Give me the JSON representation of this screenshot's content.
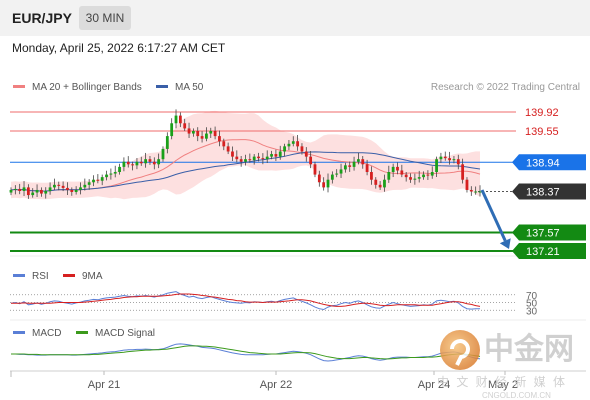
{
  "header": {
    "symbol": "EUR/JPY",
    "timeframe": "30 MIN"
  },
  "datetime": "Monday, April 25, 2022 6:17:27 AM CET",
  "colors": {
    "ma20": "#f08080",
    "ma50": "#3a5fa8",
    "bollinger_fill": "#fde0e0",
    "resistance": "#ef6b6b",
    "pivot": "#1a73e8",
    "support": "#138a13",
    "price": "#333333",
    "arrow": "#2f6db5",
    "rsi": "#5a7fd6",
    "rsi_ma": "#d62020",
    "macd": "#5a7fd6",
    "macd_signal": "#3c9a1c",
    "candle_up": "#1aa01a",
    "candle_down": "#d62020"
  },
  "chart_data": [
    {
      "type": "candlestick",
      "title": "",
      "legend": [
        {
          "name": "MA 20 + Bollinger Bands",
          "color": "#f08080"
        },
        {
          "name": "MA 50",
          "color": "#3a5fa8"
        }
      ],
      "legend_position": "top-left",
      "credit": "Research © 2022 Trading Central",
      "x_tick_labels": [
        "Apr 21",
        "Apr 22",
        "Apr 24",
        "May 2"
      ],
      "ylim": [
        137.1,
        140.05
      ],
      "current_price": 138.37,
      "levels": [
        {
          "label": "139.92",
          "value": 139.92,
          "role": "resistance"
        },
        {
          "label": "139.55",
          "value": 139.55,
          "role": "resistance"
        },
        {
          "label": "138.94",
          "value": 138.94,
          "role": "pivot"
        },
        {
          "label": "138.37",
          "value": 138.37,
          "role": "price"
        },
        {
          "label": "137.57",
          "value": 137.57,
          "role": "support"
        },
        {
          "label": "137.21",
          "value": 137.21,
          "role": "support"
        }
      ],
      "forecast_arrow": {
        "from": 138.4,
        "to": 137.25
      },
      "close_series": [
        138.4,
        138.42,
        138.38,
        138.45,
        138.3,
        138.35,
        138.4,
        138.33,
        138.38,
        138.45,
        138.5,
        138.48,
        138.44,
        138.4,
        138.36,
        138.4,
        138.45,
        138.5,
        138.55,
        138.6,
        138.58,
        138.65,
        138.7,
        138.72,
        138.75,
        138.85,
        138.95,
        138.9,
        138.88,
        138.95,
        138.92,
        139.0,
        138.95,
        138.9,
        139.0,
        139.2,
        139.45,
        139.7,
        139.85,
        139.7,
        139.6,
        139.5,
        139.55,
        139.45,
        139.4,
        139.5,
        139.55,
        139.45,
        139.35,
        139.25,
        139.15,
        139.05,
        139.0,
        138.95,
        139.0,
        138.98,
        139.05,
        139.02,
        139.0,
        139.05,
        139.1,
        139.05,
        139.15,
        139.25,
        139.3,
        139.35,
        139.25,
        139.15,
        139.05,
        138.9,
        138.7,
        138.55,
        138.45,
        138.6,
        138.7,
        138.72,
        138.8,
        138.88,
        138.85,
        138.95,
        139.0,
        138.9,
        138.75,
        138.6,
        138.5,
        138.45,
        138.6,
        138.75,
        138.85,
        138.78,
        138.7,
        138.65,
        138.6,
        138.62,
        138.65,
        138.7,
        138.68,
        138.75,
        139.0,
        139.05,
        139.02,
        138.98,
        139.0,
        138.9,
        138.6,
        138.4,
        138.37,
        138.37,
        138.37
      ]
    },
    {
      "type": "line",
      "title": "RSI",
      "series": [
        {
          "name": "RSI"
        },
        {
          "name": "9MA"
        }
      ],
      "y_tick_labels": [
        "70",
        "50",
        "30"
      ],
      "levels": [
        70,
        50,
        30
      ],
      "ylim": [
        10,
        90
      ],
      "rsi": [
        48,
        50,
        47,
        52,
        44,
        46,
        49,
        45,
        48,
        52,
        54,
        53,
        50,
        48,
        46,
        49,
        51,
        54,
        56,
        58,
        57,
        60,
        62,
        63,
        64,
        66,
        68,
        66,
        65,
        67,
        66,
        68,
        66,
        64,
        67,
        70,
        74,
        76,
        78,
        72,
        68,
        64,
        66,
        62,
        60,
        63,
        65,
        61,
        58,
        55,
        52,
        50,
        49,
        48,
        50,
        49,
        52,
        51,
        50,
        52,
        53,
        51,
        55,
        58,
        60,
        62,
        57,
        53,
        49,
        44,
        38,
        34,
        32,
        38,
        42,
        43,
        47,
        50,
        48,
        52,
        54,
        50,
        44,
        39,
        36,
        35,
        41,
        46,
        50,
        47,
        44,
        42,
        40,
        41,
        42,
        44,
        43,
        46,
        54,
        56,
        54,
        52,
        53,
        49,
        40,
        34,
        33,
        34,
        34
      ],
      "ma9": [
        48,
        48,
        48,
        49,
        48,
        48,
        48,
        48,
        48,
        48,
        49,
        50,
        50,
        50,
        50,
        50,
        50,
        51,
        52,
        53,
        54,
        56,
        57,
        58,
        60,
        61,
        63,
        64,
        65,
        65,
        66,
        66,
        66,
        66,
        66,
        67,
        68,
        69,
        71,
        72,
        72,
        72,
        71,
        70,
        68,
        67,
        65,
        64,
        62,
        60,
        58,
        57,
        55,
        54,
        52,
        51,
        51,
        51,
        50,
        51,
        51,
        51,
        52,
        53,
        54,
        56,
        57,
        57,
        56,
        54,
        51,
        48,
        45,
        43,
        41,
        40,
        40,
        41,
        43,
        45,
        47,
        48,
        48,
        47,
        45,
        43,
        42,
        42,
        43,
        44,
        44,
        44,
        44,
        44,
        43,
        43,
        43,
        43,
        45,
        47,
        49,
        51,
        52,
        52,
        50,
        47,
        45,
        42,
        40
      ]
    },
    {
      "type": "line",
      "title": "MACD",
      "series": [
        {
          "name": "MACD"
        },
        {
          "name": "MACD Signal"
        }
      ],
      "ylim": [
        -0.4,
        0.4
      ],
      "macd": [
        0.0,
        0.0,
        -0.01,
        -0.01,
        -0.02,
        -0.02,
        -0.03,
        -0.03,
        -0.03,
        -0.02,
        -0.02,
        -0.02,
        -0.02,
        -0.02,
        -0.03,
        -0.03,
        -0.02,
        -0.01,
        0.0,
        0.01,
        0.02,
        0.03,
        0.05,
        0.06,
        0.07,
        0.09,
        0.11,
        0.12,
        0.12,
        0.13,
        0.13,
        0.14,
        0.13,
        0.12,
        0.13,
        0.15,
        0.19,
        0.24,
        0.28,
        0.29,
        0.28,
        0.26,
        0.24,
        0.22,
        0.19,
        0.18,
        0.17,
        0.15,
        0.12,
        0.09,
        0.06,
        0.03,
        0.01,
        -0.01,
        -0.02,
        -0.02,
        -0.02,
        -0.02,
        -0.02,
        -0.01,
        0.0,
        0.0,
        0.02,
        0.04,
        0.06,
        0.08,
        0.07,
        0.05,
        0.02,
        -0.02,
        -0.08,
        -0.14,
        -0.19,
        -0.2,
        -0.19,
        -0.17,
        -0.15,
        -0.12,
        -0.1,
        -0.07,
        -0.05,
        -0.06,
        -0.09,
        -0.13,
        -0.16,
        -0.18,
        -0.16,
        -0.13,
        -0.1,
        -0.09,
        -0.09,
        -0.09,
        -0.1,
        -0.1,
        -0.09,
        -0.08,
        -0.08,
        -0.06,
        -0.02,
        0.02,
        0.04,
        0.05,
        0.06,
        0.04,
        0.0,
        -0.05,
        -0.09,
        -0.12,
        -0.14
      ],
      "signal": [
        0.0,
        0.0,
        0.0,
        0.0,
        -0.01,
        -0.01,
        -0.01,
        -0.02,
        -0.02,
        -0.02,
        -0.02,
        -0.02,
        -0.02,
        -0.02,
        -0.02,
        -0.02,
        -0.02,
        -0.02,
        -0.02,
        -0.01,
        -0.01,
        0.0,
        0.01,
        0.02,
        0.03,
        0.04,
        0.05,
        0.07,
        0.08,
        0.09,
        0.1,
        0.11,
        0.11,
        0.12,
        0.12,
        0.13,
        0.14,
        0.16,
        0.18,
        0.2,
        0.22,
        0.23,
        0.23,
        0.23,
        0.22,
        0.22,
        0.21,
        0.2,
        0.18,
        0.16,
        0.14,
        0.12,
        0.1,
        0.08,
        0.06,
        0.04,
        0.03,
        0.02,
        0.01,
        0.0,
        0.0,
        0.0,
        0.0,
        0.01,
        0.02,
        0.03,
        0.04,
        0.04,
        0.04,
        0.03,
        0.01,
        -0.02,
        -0.05,
        -0.08,
        -0.1,
        -0.12,
        -0.13,
        -0.13,
        -0.13,
        -0.12,
        -0.11,
        -0.1,
        -0.1,
        -0.11,
        -0.12,
        -0.13,
        -0.14,
        -0.14,
        -0.13,
        -0.12,
        -0.11,
        -0.11,
        -0.1,
        -0.1,
        -0.1,
        -0.1,
        -0.09,
        -0.09,
        -0.08,
        -0.06,
        -0.04,
        -0.02,
        -0.01,
        0.0,
        0.0,
        -0.01,
        -0.03,
        -0.05,
        -0.07
      ]
    }
  ],
  "watermark": {
    "brand": "中金网",
    "subtitle": "中 文 财 经 新 媒 体",
    "domain": "CNGOLD.COM.CN"
  }
}
